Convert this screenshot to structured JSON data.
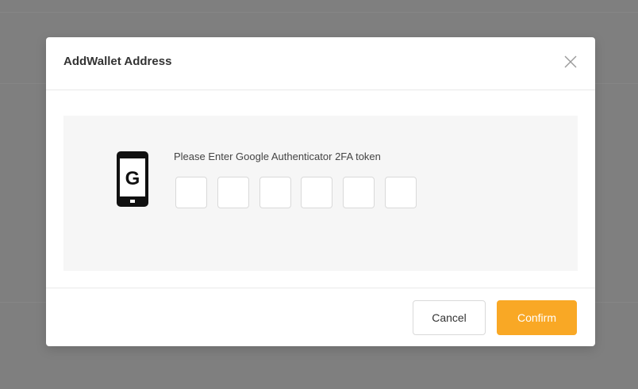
{
  "modal": {
    "title": "AddWallet Address",
    "close_icon": "close-icon"
  },
  "body": {
    "icon": "google-authenticator-phone-icon",
    "icon_letter": "G",
    "prompt": "Please Enter Google Authenticator 2FA token",
    "token_digits": [
      "",
      "",
      "",
      "",
      "",
      ""
    ]
  },
  "footer": {
    "cancel_label": "Cancel",
    "confirm_label": "Confirm"
  },
  "colors": {
    "backdrop": "#7f7f7f",
    "accent": "#f9a825",
    "panel": "#f6f6f6"
  }
}
